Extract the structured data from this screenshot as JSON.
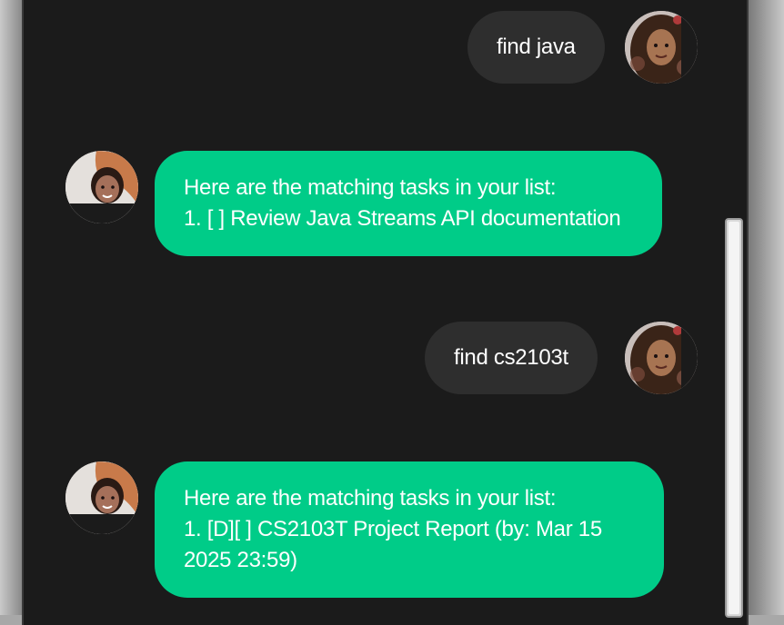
{
  "messages": [
    {
      "role": "user",
      "text": "find java"
    },
    {
      "role": "bot",
      "lines": [
        "Here are the matching tasks in your list:",
        "1. [ ] Review Java Streams API documentation"
      ]
    },
    {
      "role": "user",
      "text": "find cs2103t"
    },
    {
      "role": "bot",
      "lines": [
        "Here are the matching tasks in your list:",
        "1. [D][ ] CS2103T Project Report (by: Mar 15",
        "2025 23:59)"
      ]
    }
  ],
  "colors": {
    "background": "#1b1b1b",
    "user_bubble": "#2e2e2e",
    "bot_bubble": "#00cc88",
    "text": "#ffffff"
  },
  "icons": {
    "user_avatar": "user-avatar",
    "bot_avatar": "bot-avatar"
  }
}
